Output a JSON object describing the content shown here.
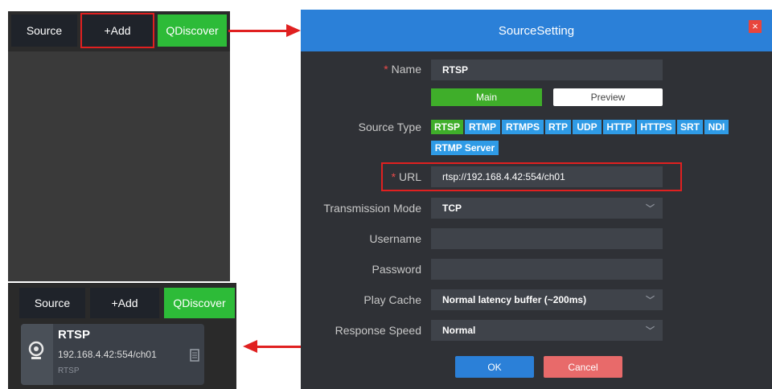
{
  "toolbar_top": {
    "source_label": "Source",
    "add_label": "+Add",
    "discover_label": "QDiscover"
  },
  "toolbar_bottom": {
    "source_label": "Source",
    "add_label": "+Add",
    "discover_label": "QDiscover"
  },
  "source_card": {
    "name": "RTSP",
    "address": "192.168.4.42:554/ch01",
    "type": "RTSP"
  },
  "dialog": {
    "title": "SourceSetting",
    "close_glyph": "×",
    "name_required": "*",
    "name_label": "Name",
    "name_value": "RTSP",
    "stream_tabs": [
      "Main",
      "Preview"
    ],
    "source_type_label": "Source Type",
    "source_types": [
      "RTSP",
      "RTMP",
      "RTMPS",
      "RTP",
      "UDP",
      "HTTP",
      "HTTPS",
      "SRT",
      "NDI",
      "RTMP Server"
    ],
    "url_required": "*",
    "url_label": "URL",
    "url_value": "rtsp://192.168.4.42:554/ch01",
    "transmission_label": "Transmission Mode",
    "transmission_value": "TCP",
    "username_label": "Username",
    "username_value": "",
    "password_label": "Password",
    "password_value": "",
    "play_cache_label": "Play Cache",
    "play_cache_value": "Normal latency buffer (~200ms)",
    "response_speed_label": "Response Speed",
    "response_speed_value": "Normal",
    "ok_label": "OK",
    "cancel_label": "Cancel"
  },
  "colors": {
    "accent_blue": "#2b80d8",
    "discover_green": "#2dbb38",
    "highlight_red": "#e02020",
    "cancel_red": "#e86a6a"
  }
}
